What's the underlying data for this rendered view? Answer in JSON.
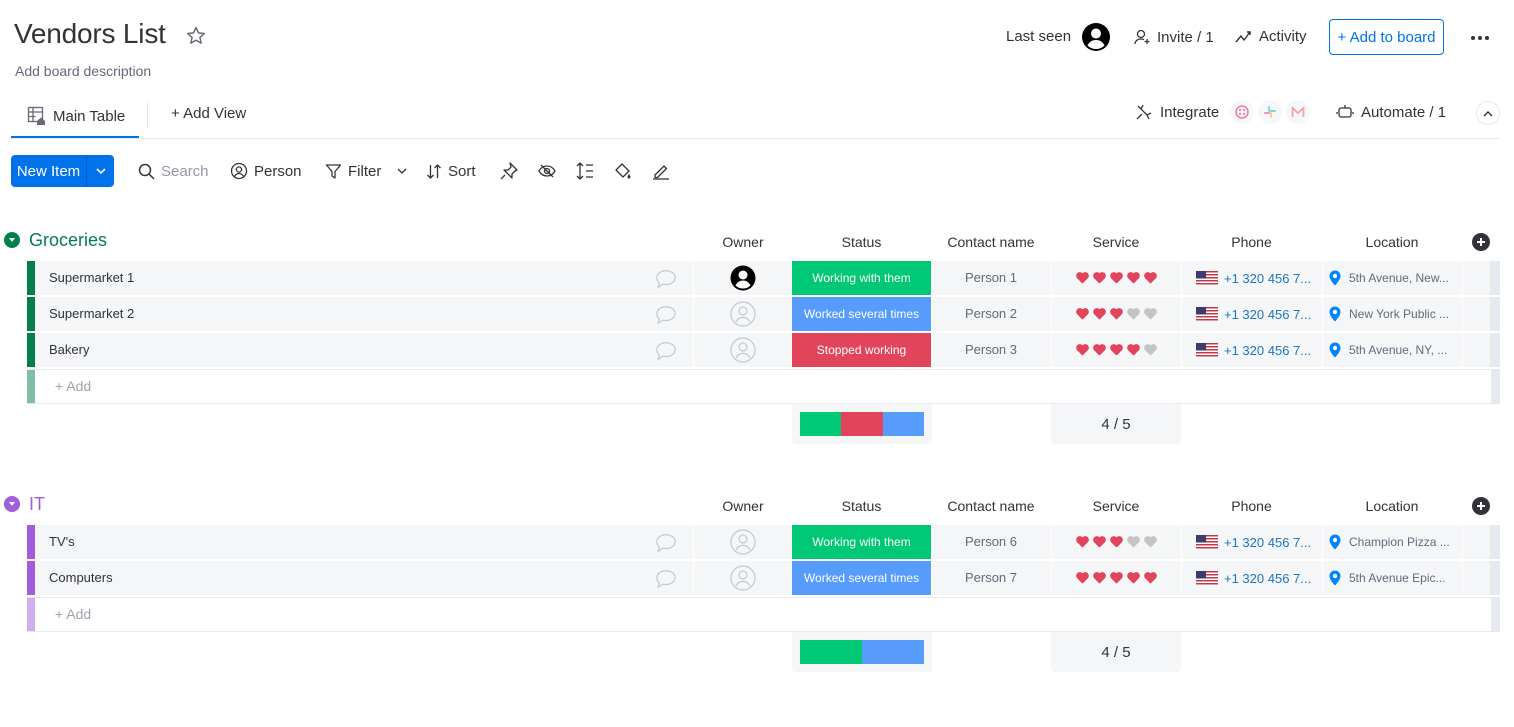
{
  "board": {
    "title": "Vendors List",
    "description": "Add board description"
  },
  "header": {
    "last_seen_label": "Last seen",
    "invite_label": "Invite / 1",
    "activity_label": "Activity",
    "add_to_board_label": "+ Add to board"
  },
  "views": {
    "main_table_label": "Main Table",
    "add_view_label": "+ Add View",
    "integrate_label": "Integrate",
    "integrations": [
      "twilio-icon",
      "slack-icon",
      "gmail-icon"
    ],
    "automate_label": "Automate / 1"
  },
  "toolbar": {
    "new_item_label": "New Item",
    "search_placeholder": "Search",
    "person_label": "Person",
    "filter_label": "Filter",
    "sort_label": "Sort"
  },
  "columns": {
    "owner": "Owner",
    "status": "Status",
    "contact": "Contact name",
    "service": "Service",
    "phone": "Phone",
    "location": "Location"
  },
  "colors": {
    "accent": "#0073ea",
    "status_working": "#00c875",
    "status_worked_several": "#579bfc",
    "status_stopped": "#e2445c",
    "heart_on": "#e2445c",
    "heart_off": "#c4c4c4",
    "group_groceries": "#037f4c",
    "group_it": "#a25ddc"
  },
  "groups": [
    {
      "name": "Groceries",
      "color": "#037f4c",
      "add_bar_color": "#81bfa5",
      "add_label": "+ Add",
      "items": [
        {
          "name": "Supermarket 1",
          "owner": "filled",
          "status": "Working with them",
          "status_color": "#00c875",
          "contact": "Person 1",
          "rating": 5,
          "rating_max": 5,
          "phone": "+1 320 456 7...",
          "location": "5th Avenue, New..."
        },
        {
          "name": "Supermarket 2",
          "owner": "empty",
          "status": "Worked several times",
          "status_color": "#579bfc",
          "contact": "Person 2",
          "rating": 3,
          "rating_max": 5,
          "phone": "+1 320 456 7...",
          "location": "New York Public ..."
        },
        {
          "name": "Bakery",
          "owner": "empty",
          "status": "Stopped working",
          "status_color": "#e2445c",
          "contact": "Person 3",
          "rating": 4,
          "rating_max": 5,
          "phone": "+1 320 456 7...",
          "location": "5th Avenue, NY, ..."
        }
      ],
      "summary": {
        "status_distribution": [
          {
            "label": "Working with them",
            "color": "#00c875",
            "count": 1
          },
          {
            "label": "Stopped working",
            "color": "#e2445c",
            "count": 1
          },
          {
            "label": "Worked several times",
            "color": "#579bfc",
            "count": 1
          }
        ],
        "rating_summary": "4 / 5"
      }
    },
    {
      "name": "IT",
      "color": "#a25ddc",
      "add_bar_color": "#d0aeed",
      "add_label": "+ Add",
      "items": [
        {
          "name": "TV's",
          "owner": "empty",
          "status": "Working with them",
          "status_color": "#00c875",
          "contact": "Person 6",
          "rating": 3,
          "rating_max": 5,
          "phone": "+1 320 456 7...",
          "location": "Champion Pizza ..."
        },
        {
          "name": "Computers",
          "owner": "empty",
          "status": "Worked several times",
          "status_color": "#579bfc",
          "contact": "Person 7",
          "rating": 5,
          "rating_max": 5,
          "phone": "+1 320 456 7...",
          "location": "5th Avenue Epic..."
        }
      ],
      "summary": {
        "status_distribution": [
          {
            "label": "Working with them",
            "color": "#00c875",
            "count": 1
          },
          {
            "label": "Worked several times",
            "color": "#579bfc",
            "count": 1
          }
        ],
        "rating_summary": "4 / 5"
      }
    }
  ]
}
